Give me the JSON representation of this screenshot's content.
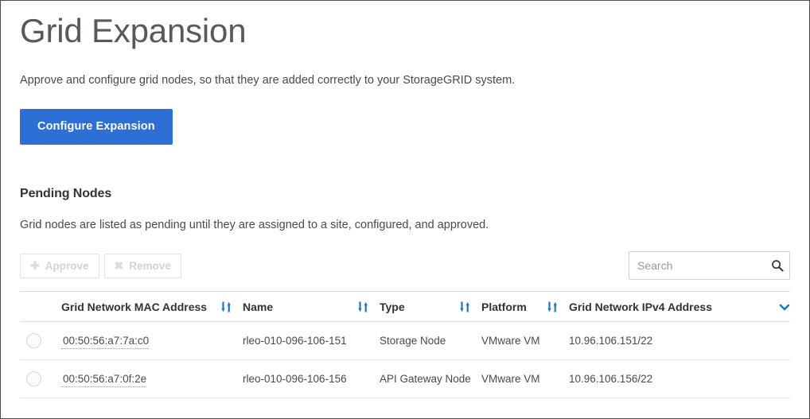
{
  "page": {
    "title": "Grid Expansion",
    "description": "Approve and configure grid nodes, so that they are added correctly to your StorageGRID system.",
    "primary_button": "Configure Expansion",
    "accent_color": "#2d6fd4",
    "title_color": "#58595b"
  },
  "pending_section": {
    "heading": "Pending Nodes",
    "description": "Grid nodes are listed as pending until they are assigned to a site, configured, and approved.",
    "toolbar": {
      "approve_label": "Approve",
      "approve_icon": "plus-icon",
      "approve_disabled": true,
      "remove_label": "Remove",
      "remove_icon": "times-icon",
      "remove_disabled": true
    },
    "search": {
      "placeholder": "Search",
      "value": "",
      "icon": "search-icon"
    },
    "table": {
      "columns": [
        {
          "key": "select",
          "label": "",
          "icon": ""
        },
        {
          "key": "mac",
          "label": "Grid Network MAC Address",
          "icon": "sort-icon"
        },
        {
          "key": "name",
          "label": "Name",
          "icon": "sort-icon"
        },
        {
          "key": "type",
          "label": "Type",
          "icon": "sort-icon"
        },
        {
          "key": "platform",
          "label": "Platform",
          "icon": "sort-icon"
        },
        {
          "key": "ip",
          "label": "Grid Network IPv4 Address",
          "icon": "chevron-down-icon"
        }
      ],
      "rows": [
        {
          "selected": false,
          "mac": "00:50:56:a7:7a:c0",
          "name": "rleo-010-096-106-151",
          "type": "Storage Node",
          "platform": "VMware VM",
          "ip": "10.96.106.151/22"
        },
        {
          "selected": false,
          "mac": "00:50:56:a7:0f:2e",
          "name": "rleo-010-096-106-156",
          "type": "API Gateway Node",
          "platform": "VMware VM",
          "ip": "10.96.106.156/22"
        }
      ]
    }
  }
}
